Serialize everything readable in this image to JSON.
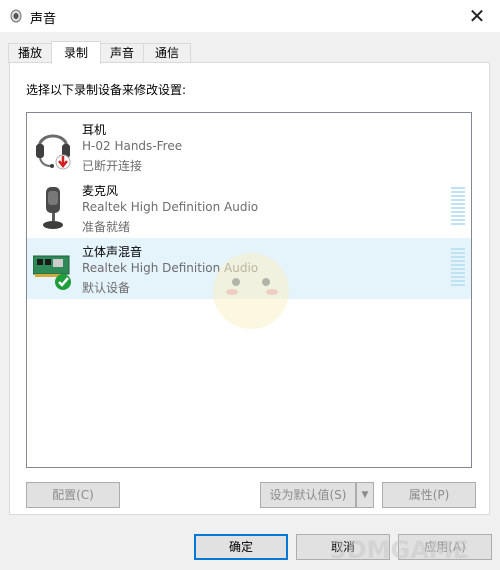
{
  "window": {
    "title": "声音",
    "close_icon": "close-icon"
  },
  "tabs": [
    {
      "label": "播放"
    },
    {
      "label": "录制"
    },
    {
      "label": "声音"
    },
    {
      "label": "通信"
    }
  ],
  "active_tab": "录制",
  "instruction": "选择以下录制设备来修改设置:",
  "devices": [
    {
      "name": "耳机",
      "desc": "H-02 Hands-Free",
      "status": "已断开连接",
      "icon": "headset-icon",
      "badge": "disconnected-badge-icon"
    },
    {
      "name": "麦克风",
      "desc": "Realtek High Definition Audio",
      "status": "准备就绪",
      "icon": "microphone-icon"
    },
    {
      "name": "立体声混音",
      "desc": "Realtek High Definition Audio",
      "status": "默认设备",
      "icon": "sound-card-icon",
      "badge": "default-check-icon",
      "selected": true
    }
  ],
  "buttons": {
    "configure": "配置(C)",
    "set_default": "设为默认值(S)",
    "properties": "属性(P)",
    "ok": "确定",
    "cancel": "取消",
    "apply": "应用(A)"
  },
  "watermark": "3DMGAME",
  "colors": {
    "selection": "#e5f3fb",
    "meter": "#bfe3f2",
    "accent": "#0078d7"
  }
}
